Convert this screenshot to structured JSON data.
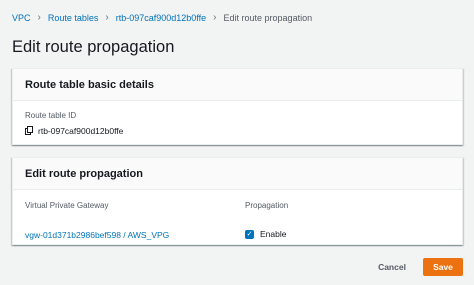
{
  "breadcrumb": {
    "items": [
      {
        "label": "VPC"
      },
      {
        "label": "Route tables"
      },
      {
        "label": "rtb-097caf900d12b0ffe"
      }
    ],
    "current": "Edit route propagation",
    "separator": "›"
  },
  "page": {
    "title": "Edit route propagation"
  },
  "basic_details": {
    "header": "Route table basic details",
    "id_label": "Route table ID",
    "id_value": "rtb-097caf900d12b0ffe",
    "copy_icon": "copy-icon"
  },
  "propagation": {
    "header": "Edit route propagation",
    "columns": [
      "Virtual Private Gateway",
      "Propagation"
    ],
    "rows": [
      {
        "gateway": "vgw-01d371b2986bef598 / AWS_VPG",
        "checkbox_glyph": "✓",
        "enabled": true,
        "toggle_label": "Enable"
      }
    ]
  },
  "footer": {
    "cancel_label": "Cancel",
    "save_label": "Save"
  },
  "colors": {
    "link": "#0073bb",
    "primary_button": "#ec7211",
    "background": "#f2f3f3"
  }
}
